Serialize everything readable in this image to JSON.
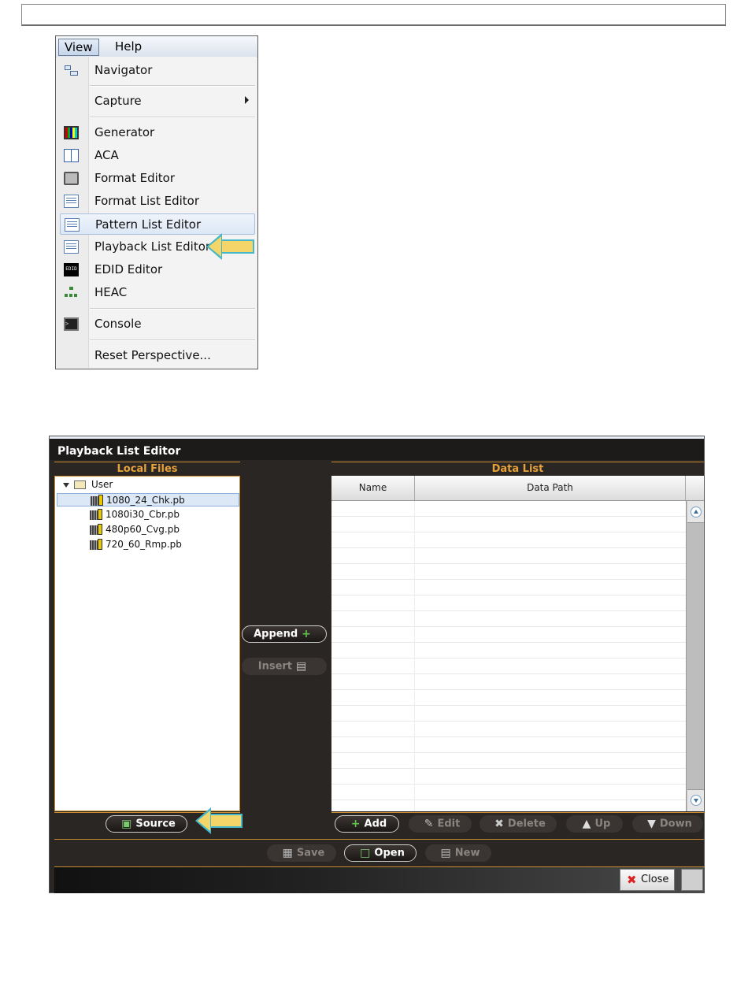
{
  "menu": {
    "bar": {
      "view_label": "View",
      "help_label": "Help"
    },
    "items": [
      {
        "label": "Navigator",
        "icon": "navigator-icon"
      },
      {
        "label": "Capture",
        "icon": "",
        "has_submenu": true
      },
      {
        "label": "Generator",
        "icon": "generator-icon"
      },
      {
        "label": "ACA",
        "icon": "aca-icon"
      },
      {
        "label": "Format Editor",
        "icon": "format-editor-icon"
      },
      {
        "label": "Format List Editor",
        "icon": "list-icon"
      },
      {
        "label": "Pattern List Editor",
        "icon": "list-icon",
        "highlighted": true
      },
      {
        "label": "Playback List Editor",
        "icon": "list-icon"
      },
      {
        "label": "EDID Editor",
        "icon": "edid-icon",
        "icon_text": "EDID"
      },
      {
        "label": "HEAC",
        "icon": "heac-icon"
      },
      {
        "label": "Console",
        "icon": "console-icon",
        "icon_text": ">"
      },
      {
        "label": "Reset Perspective...",
        "icon": ""
      }
    ]
  },
  "editor": {
    "title": "Playback List Editor",
    "local_files": {
      "header": "Local Files",
      "root": "User",
      "files": [
        "1080_24_Chk.pb",
        "1080i30_Cbr.pb",
        "480p60_Cvg.pb",
        "720_60_Rmp.pb"
      ],
      "selected_index": 0,
      "source_label": "Source"
    },
    "middle": {
      "append_label": "Append",
      "insert_label": "Insert"
    },
    "data_list": {
      "header": "Data List",
      "columns": [
        "Name",
        "Data Path"
      ],
      "rows": []
    },
    "list_buttons": {
      "add": "Add",
      "edit": "Edit",
      "delete": "Delete",
      "up": "Up",
      "down": "Down"
    },
    "file_buttons": {
      "save": "Save",
      "open": "Open",
      "new": "New"
    },
    "close_label": "Close"
  },
  "colors": {
    "accent": "#e8a23a",
    "panel_bg": "#2a2624",
    "arrow_fill": "#f3d56a",
    "arrow_stroke": "#46b7c8"
  }
}
